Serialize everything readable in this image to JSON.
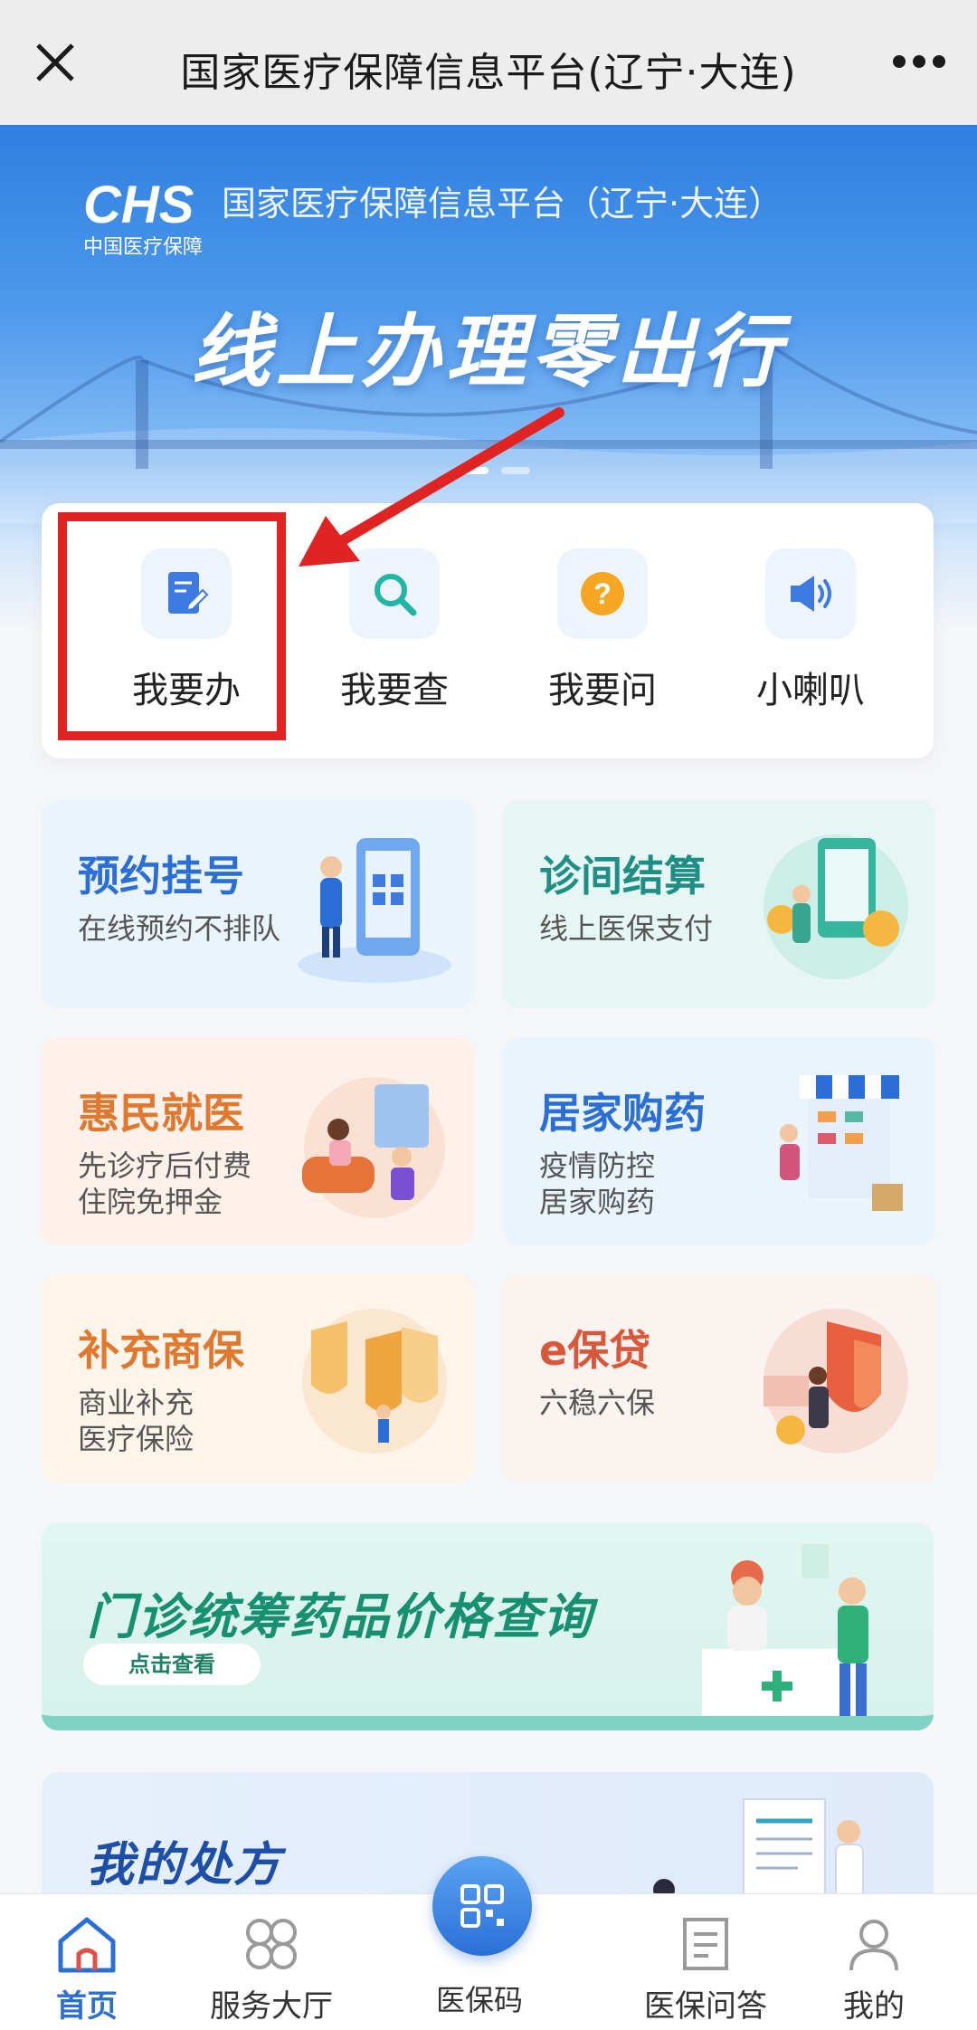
{
  "top_bar": {
    "close_icon": "close-icon",
    "title": "国家医疗保障信息平台(辽宁·大连)",
    "more_icon": "more-icon"
  },
  "banner": {
    "logo_text": "CHS",
    "logo_sub": "中国医疗保障",
    "platform": "国家医疗保障信息平台（辽宁·大连）",
    "slogan": "线上办理零出行"
  },
  "quick_actions": [
    {
      "label": "我要办",
      "icon": "edit-doc-icon"
    },
    {
      "label": "我要查",
      "icon": "search-icon"
    },
    {
      "label": "我要问",
      "icon": "question-icon"
    },
    {
      "label": "小喇叭",
      "icon": "speaker-icon"
    }
  ],
  "services": [
    {
      "title": "预约挂号",
      "subtitle": "在线预约不排队",
      "color": "#2b6fd6"
    },
    {
      "title": "诊间结算",
      "subtitle": "线上医保支付",
      "color": "#1f8e84"
    },
    {
      "title": "惠民就医",
      "subtitle": "先诊疗后付费",
      "subtitle2": "住院免押金",
      "color": "#e0792f"
    },
    {
      "title": "居家购药",
      "subtitle": "疫情防控",
      "subtitle2": "居家购药",
      "color": "#2b6fd6"
    },
    {
      "title": "补充商保",
      "subtitle": "商业补充",
      "subtitle2": "医疗保险",
      "color": "#e0792f"
    },
    {
      "title": "e保贷",
      "subtitle": "六稳六保",
      "color": "#d9573a"
    }
  ],
  "price_query": {
    "title": "门诊统筹药品价格查询",
    "button": "点击查看"
  },
  "prescription": {
    "title": "我的处方"
  },
  "bottom_nav": [
    {
      "label": "首页",
      "icon": "home-icon",
      "active": true
    },
    {
      "label": "服务大厅",
      "icon": "service-hall-icon",
      "active": false
    },
    {
      "label": "医保码",
      "icon": "qr-code-icon",
      "active": false
    },
    {
      "label": "医保问答",
      "icon": "qa-doc-icon",
      "active": false
    },
    {
      "label": "我的",
      "icon": "user-icon",
      "active": false
    }
  ]
}
